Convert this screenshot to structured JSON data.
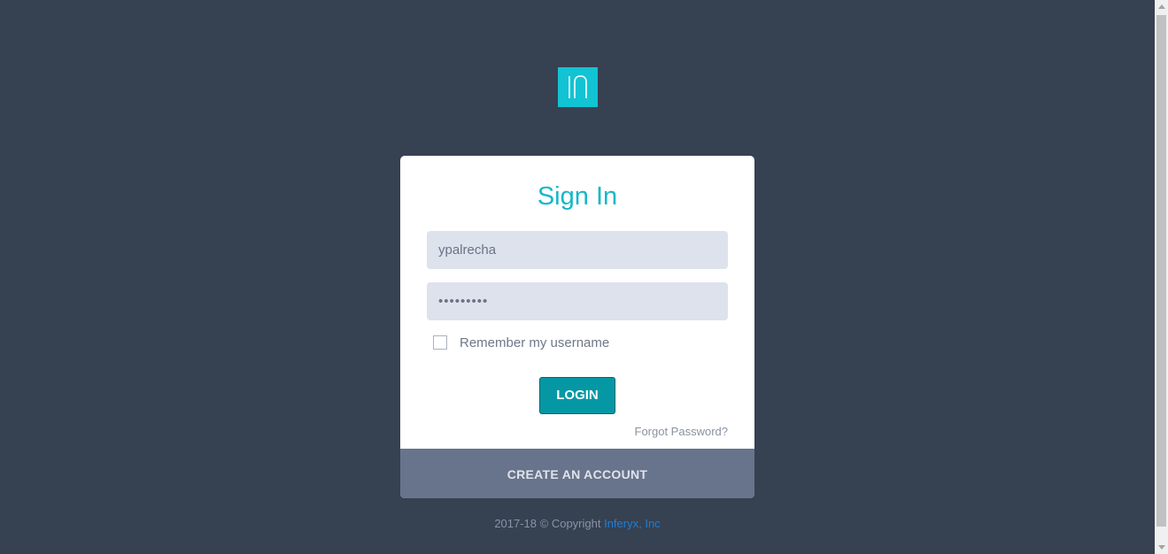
{
  "logo": {
    "text": "In",
    "color": "#12c3d4"
  },
  "signin": {
    "title": "Sign In",
    "username_value": "ypalrecha",
    "password_value": "•••••••••",
    "remember_label": "Remember my username",
    "remember_checked": false,
    "login_label": "LOGIN",
    "forgot_label": "Forgot Password?",
    "create_account_label": "CREATE AN ACCOUNT"
  },
  "footer": {
    "copyright": "2017-18 © Copyright",
    "company": "Inferyx, Inc"
  },
  "colors": {
    "background": "#364152",
    "accent": "#12c3d4",
    "button": "#0598a4",
    "create_bar": "#68748c",
    "link": "#1e7fd6"
  }
}
